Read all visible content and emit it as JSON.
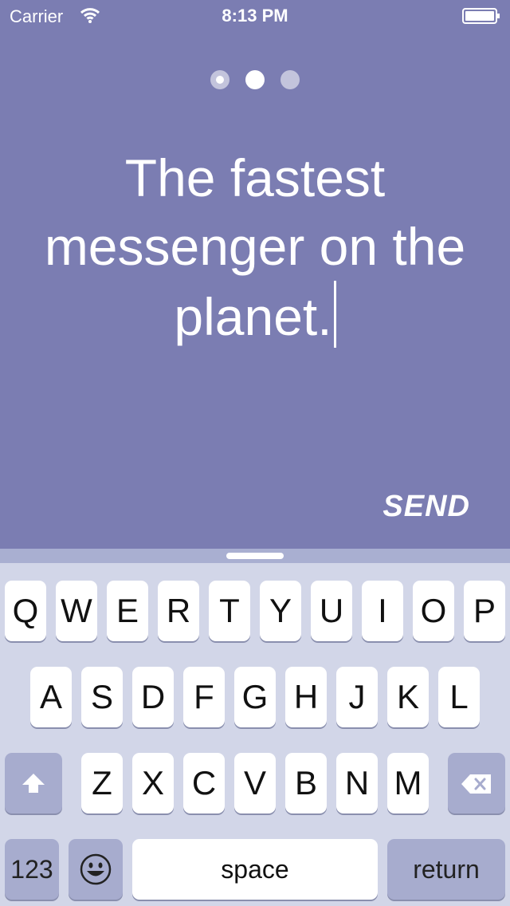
{
  "status_bar": {
    "carrier": "Carrier",
    "time": "8:13 PM"
  },
  "onboarding": {
    "page_count": 3,
    "active_page": 2,
    "headline": "The fastest messenger on the planet.",
    "send_label": "SEND"
  },
  "keyboard": {
    "row1": [
      "Q",
      "W",
      "E",
      "R",
      "T",
      "Y",
      "U",
      "I",
      "O",
      "P"
    ],
    "row2": [
      "A",
      "S",
      "D",
      "F",
      "G",
      "H",
      "J",
      "K",
      "L"
    ],
    "row3": [
      "Z",
      "X",
      "C",
      "V",
      "B",
      "N",
      "M"
    ],
    "numbers_label": "123",
    "space_label": "space",
    "return_label": "return",
    "shift_icon": "shift-up-arrow-icon",
    "delete_icon": "backspace-icon",
    "emoji_icon": "emoji-face-icon"
  },
  "colors": {
    "background": "#7b7db2",
    "keyboard": "#d2d6e8",
    "key_dark": "#a7acce"
  }
}
